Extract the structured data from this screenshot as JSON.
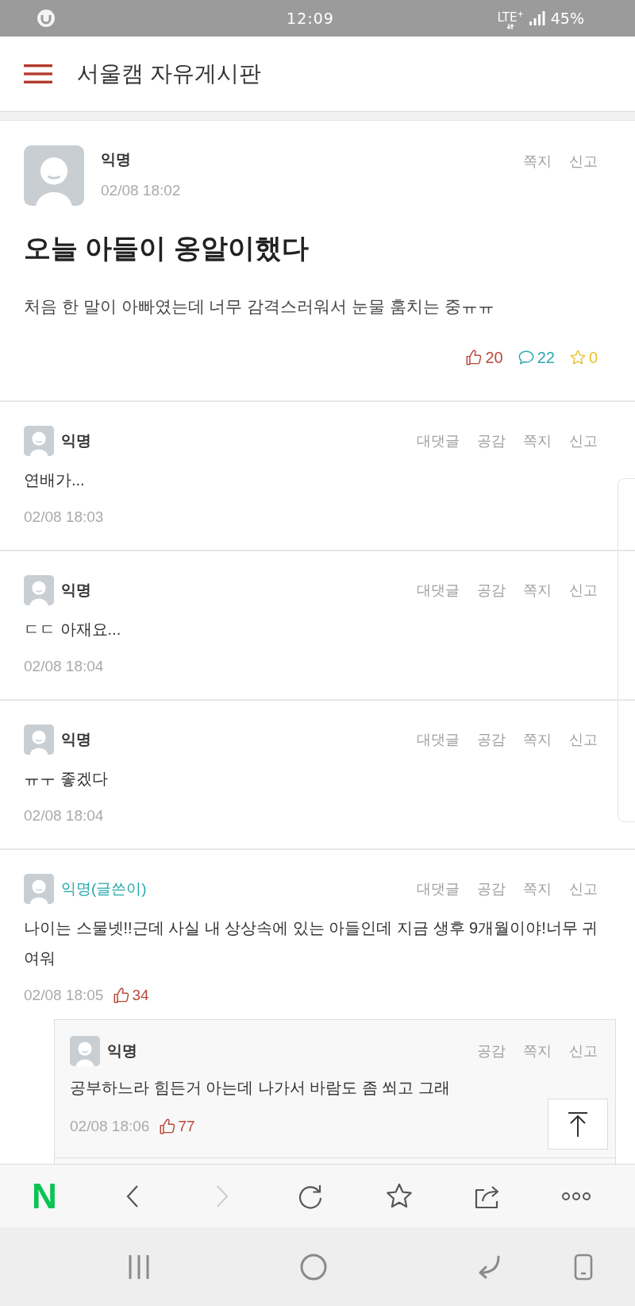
{
  "status_bar": {
    "time": "12:09",
    "network": "LTE$^{+}$",
    "battery": "45%"
  },
  "header": {
    "title": "서울캠 자유게시판"
  },
  "post": {
    "author": "익명",
    "date": "02/08 18:02",
    "actions": [
      "쪽지",
      "신고"
    ],
    "title": "오늘 아들이 옹알이했다",
    "body": "처음 한 말이 아빠였는데 너무 감격스러워서 눈물 훔치는 중ㅠㅠ",
    "stats": [
      {
        "kind": "like",
        "count": "20"
      },
      {
        "kind": "comment",
        "count": "22"
      },
      {
        "kind": "scrap",
        "count": "0"
      }
    ]
  },
  "comments": [
    {
      "author": "익명",
      "is_author": false,
      "actions": [
        "대댓글",
        "공감",
        "쪽지",
        "신고"
      ],
      "body": "연배가...",
      "date": "02/08 18:03"
    },
    {
      "author": "익명",
      "is_author": false,
      "actions": [
        "대댓글",
        "공감",
        "쪽지",
        "신고"
      ],
      "body": "ㄷㄷ 아재요...",
      "date": "02/08 18:04"
    },
    {
      "author": "익명",
      "is_author": false,
      "actions": [
        "대댓글",
        "공감",
        "쪽지",
        "신고"
      ],
      "body": "ㅠㅜ 좋겠다",
      "date": "02/08 18:04"
    },
    {
      "author": "익명(글쓴이)",
      "is_author": true,
      "actions": [
        "대댓글",
        "공감",
        "쪽지",
        "신고"
      ],
      "body": "나이는 스물넷!!근데 사실 내 상상속에 있는 아들인데 지금 생후 9개월이야!너무 귀여워",
      "date": "02/08 18:05",
      "likes": "34",
      "replies": [
        {
          "author": "익명",
          "is_author": false,
          "actions": [
            "공감",
            "쪽지",
            "신고"
          ],
          "body": "공부하느라 힘든거 아는데 나가서 바람도 좀 쐬고 그래",
          "date": "02/08 18:06",
          "likes": "77"
        }
      ]
    }
  ],
  "browser_toolbar": {
    "buttons": [
      {
        "kind": "logo",
        "label": "N",
        "disabled": false
      },
      {
        "kind": "back",
        "disabled": false
      },
      {
        "kind": "forward",
        "disabled": true
      },
      {
        "kind": "refresh",
        "disabled": false
      },
      {
        "kind": "bookmark",
        "disabled": false
      },
      {
        "kind": "share",
        "disabled": false
      },
      {
        "kind": "more",
        "disabled": false
      }
    ]
  },
  "nav_bar": {
    "buttons": [
      {
        "kind": "recents"
      },
      {
        "kind": "home"
      },
      {
        "kind": "back"
      },
      {
        "kind": "rotate"
      }
    ]
  }
}
